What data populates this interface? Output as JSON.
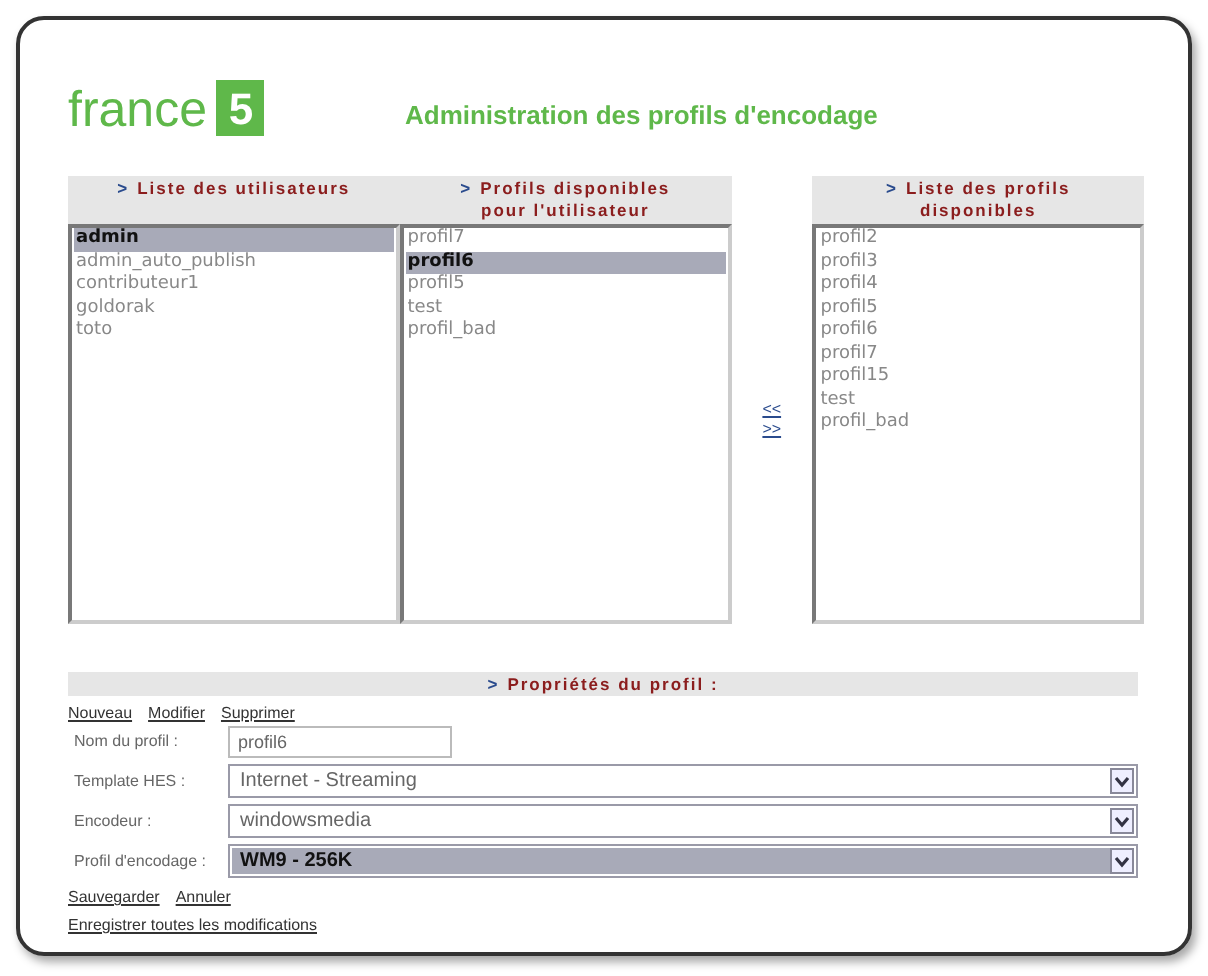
{
  "logo": {
    "word": "france",
    "digit": "5"
  },
  "title": "Administration des profils d'encodage",
  "users": {
    "marker": ">",
    "header_lines": [
      "Liste des utilisateurs"
    ],
    "items": [
      {
        "label": "admin",
        "selected": true
      },
      {
        "label": "admin_auto_publish",
        "selected": false
      },
      {
        "label": "contributeur1",
        "selected": false
      },
      {
        "label": "goldorak",
        "selected": false
      },
      {
        "label": "toto",
        "selected": false
      }
    ]
  },
  "user_profiles": {
    "marker": ">",
    "header_lines": [
      "Profils disponibles",
      "pour l'utilisateur"
    ],
    "items": [
      {
        "label": "profil7",
        "selected": false
      },
      {
        "label": "profil6",
        "selected": true
      },
      {
        "label": "profil5",
        "selected": false
      },
      {
        "label": "test",
        "selected": false
      },
      {
        "label": "profil_bad",
        "selected": false
      }
    ]
  },
  "transfer_links": [
    "<<",
    ">>"
  ],
  "available_profiles": {
    "marker": ">",
    "header_lines": [
      "Liste des profils",
      "disponibles"
    ],
    "items": [
      {
        "label": "profil2",
        "selected": false
      },
      {
        "label": "profil3",
        "selected": false
      },
      {
        "label": "profil4",
        "selected": false
      },
      {
        "label": "profil5",
        "selected": false
      },
      {
        "label": "profil6",
        "selected": false
      },
      {
        "label": "profil7",
        "selected": false
      },
      {
        "label": "profil15",
        "selected": false
      },
      {
        "label": "test",
        "selected": false
      },
      {
        "label": "profil_bad",
        "selected": false
      }
    ]
  },
  "properties": {
    "marker": ">",
    "header": "Propriétés du profil :",
    "actions": [
      "Nouveau",
      "Modifier",
      "Supprimer"
    ],
    "fields": [
      {
        "kind": "text",
        "label": "Nom du profil :",
        "value": "profil6"
      },
      {
        "kind": "select",
        "label": "Template HES :",
        "value": "Internet - Streaming",
        "selected": false
      },
      {
        "kind": "select",
        "label": "Encodeur :",
        "value": "windowsmedia",
        "selected": false
      },
      {
        "kind": "select",
        "label": "Profil d'encodage :",
        "value": "WM9 - 256K",
        "selected": true
      }
    ],
    "footer_links": [
      [
        "Sauvegarder",
        "Annuler"
      ],
      [
        "Enregistrer toutes les modifications"
      ]
    ]
  }
}
